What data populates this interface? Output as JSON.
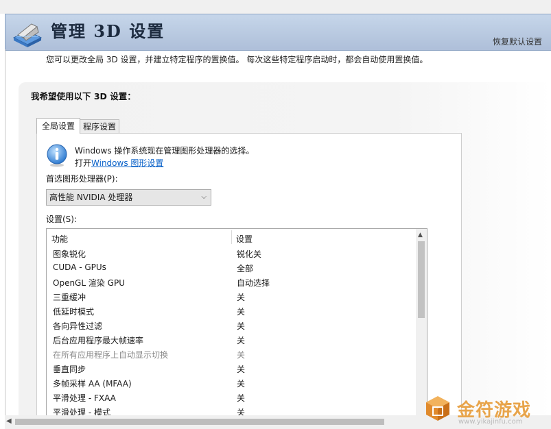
{
  "header": {
    "title": "管理 3D 设置",
    "restore_label": "恢复默认设置",
    "description": "您可以更改全局 3D 设置，并建立特定程序的置换值。 每次这些特定程序启动时，都会自动使用置换值。"
  },
  "section": {
    "title": "我希望使用以下 3D 设置："
  },
  "tabs": [
    {
      "label": "全局设置",
      "active": true
    },
    {
      "label": "程序设置",
      "active": false
    }
  ],
  "info": {
    "line1": "Windows 操作系统现在管理图形处理器的选择。",
    "line2_prefix": "打开",
    "link_text": "Windows 图形设置"
  },
  "preferred_gpu": {
    "label": "首选图形处理器(P):",
    "selected": "高性能 NVIDIA 处理器"
  },
  "settings": {
    "label": "设置(S):",
    "columns": [
      "功能",
      "设置"
    ],
    "rows": [
      {
        "feature": "图象锐化",
        "value": "锐化关"
      },
      {
        "feature": "CUDA - GPUs",
        "value": "全部"
      },
      {
        "feature": "OpenGL 渲染 GPU",
        "value": "自动选择"
      },
      {
        "feature": "三重缓冲",
        "value": "关"
      },
      {
        "feature": "低延时模式",
        "value": "关"
      },
      {
        "feature": "各向异性过滤",
        "value": "关"
      },
      {
        "feature": "后台应用程序最大帧速率",
        "value": "关"
      },
      {
        "feature": "在所有应用程序上自动显示切换",
        "value": "关",
        "disabled": true
      },
      {
        "feature": "垂直同步",
        "value": "关"
      },
      {
        "feature": "多帧采样 AA (MFAA)",
        "value": "关"
      },
      {
        "feature": "平滑处理 - FXAA",
        "value": "关"
      },
      {
        "feature": "平滑处理 - 模式",
        "value": "关"
      }
    ]
  },
  "watermark": {
    "brand": "金符游戏",
    "url": "www.yikajinfu.com"
  },
  "colors": {
    "banner": "#b9c9e0",
    "link": "#0a62c9",
    "watermark": "#e8a44a"
  }
}
